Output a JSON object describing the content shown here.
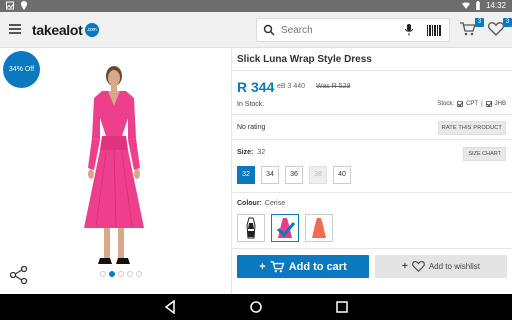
{
  "statusbar": {
    "time": "14:32"
  },
  "appbar": {
    "logo_text": "takealot",
    "logo_badge": ".com",
    "search_placeholder": "Search",
    "cart_count": "3",
    "wishlist_count": "3"
  },
  "gallery": {
    "discount": "34% Off",
    "image_count": 5,
    "active_index": 1
  },
  "product": {
    "title": "Slick Luna Wrap Style Dress",
    "price": "R 344",
    "ebucks": "eB 3 440",
    "was_price": "Was R 529",
    "availability": "In Stock.",
    "stock_label": "Stock:",
    "stock_cpt": "CPT",
    "stock_sep": "|",
    "stock_jhb": "JHB",
    "rating": "No rating",
    "rate_button": "RATE THIS PRODUCT",
    "size_label": "Size:",
    "size_selected": "32",
    "size_chart_button": "SIZE CHART",
    "sizes": [
      {
        "label": "32",
        "state": "selected"
      },
      {
        "label": "34",
        "state": "available"
      },
      {
        "label": "36",
        "state": "available"
      },
      {
        "label": "38",
        "state": "disabled"
      },
      {
        "label": "40",
        "state": "available"
      }
    ],
    "colour_label": "Colour:",
    "colour_selected": "Cerise",
    "swatches": [
      {
        "name": "black-white",
        "color": "#222222"
      },
      {
        "name": "cerise",
        "color": "#e63b8a"
      },
      {
        "name": "coral",
        "color": "#f26d4f"
      }
    ],
    "add_to_cart": "Add to cart",
    "add_to_wishlist": "Add to wishlist"
  },
  "colors": {
    "brand_blue": "#0b79bf",
    "dress_pink": "#ee3f8d"
  }
}
